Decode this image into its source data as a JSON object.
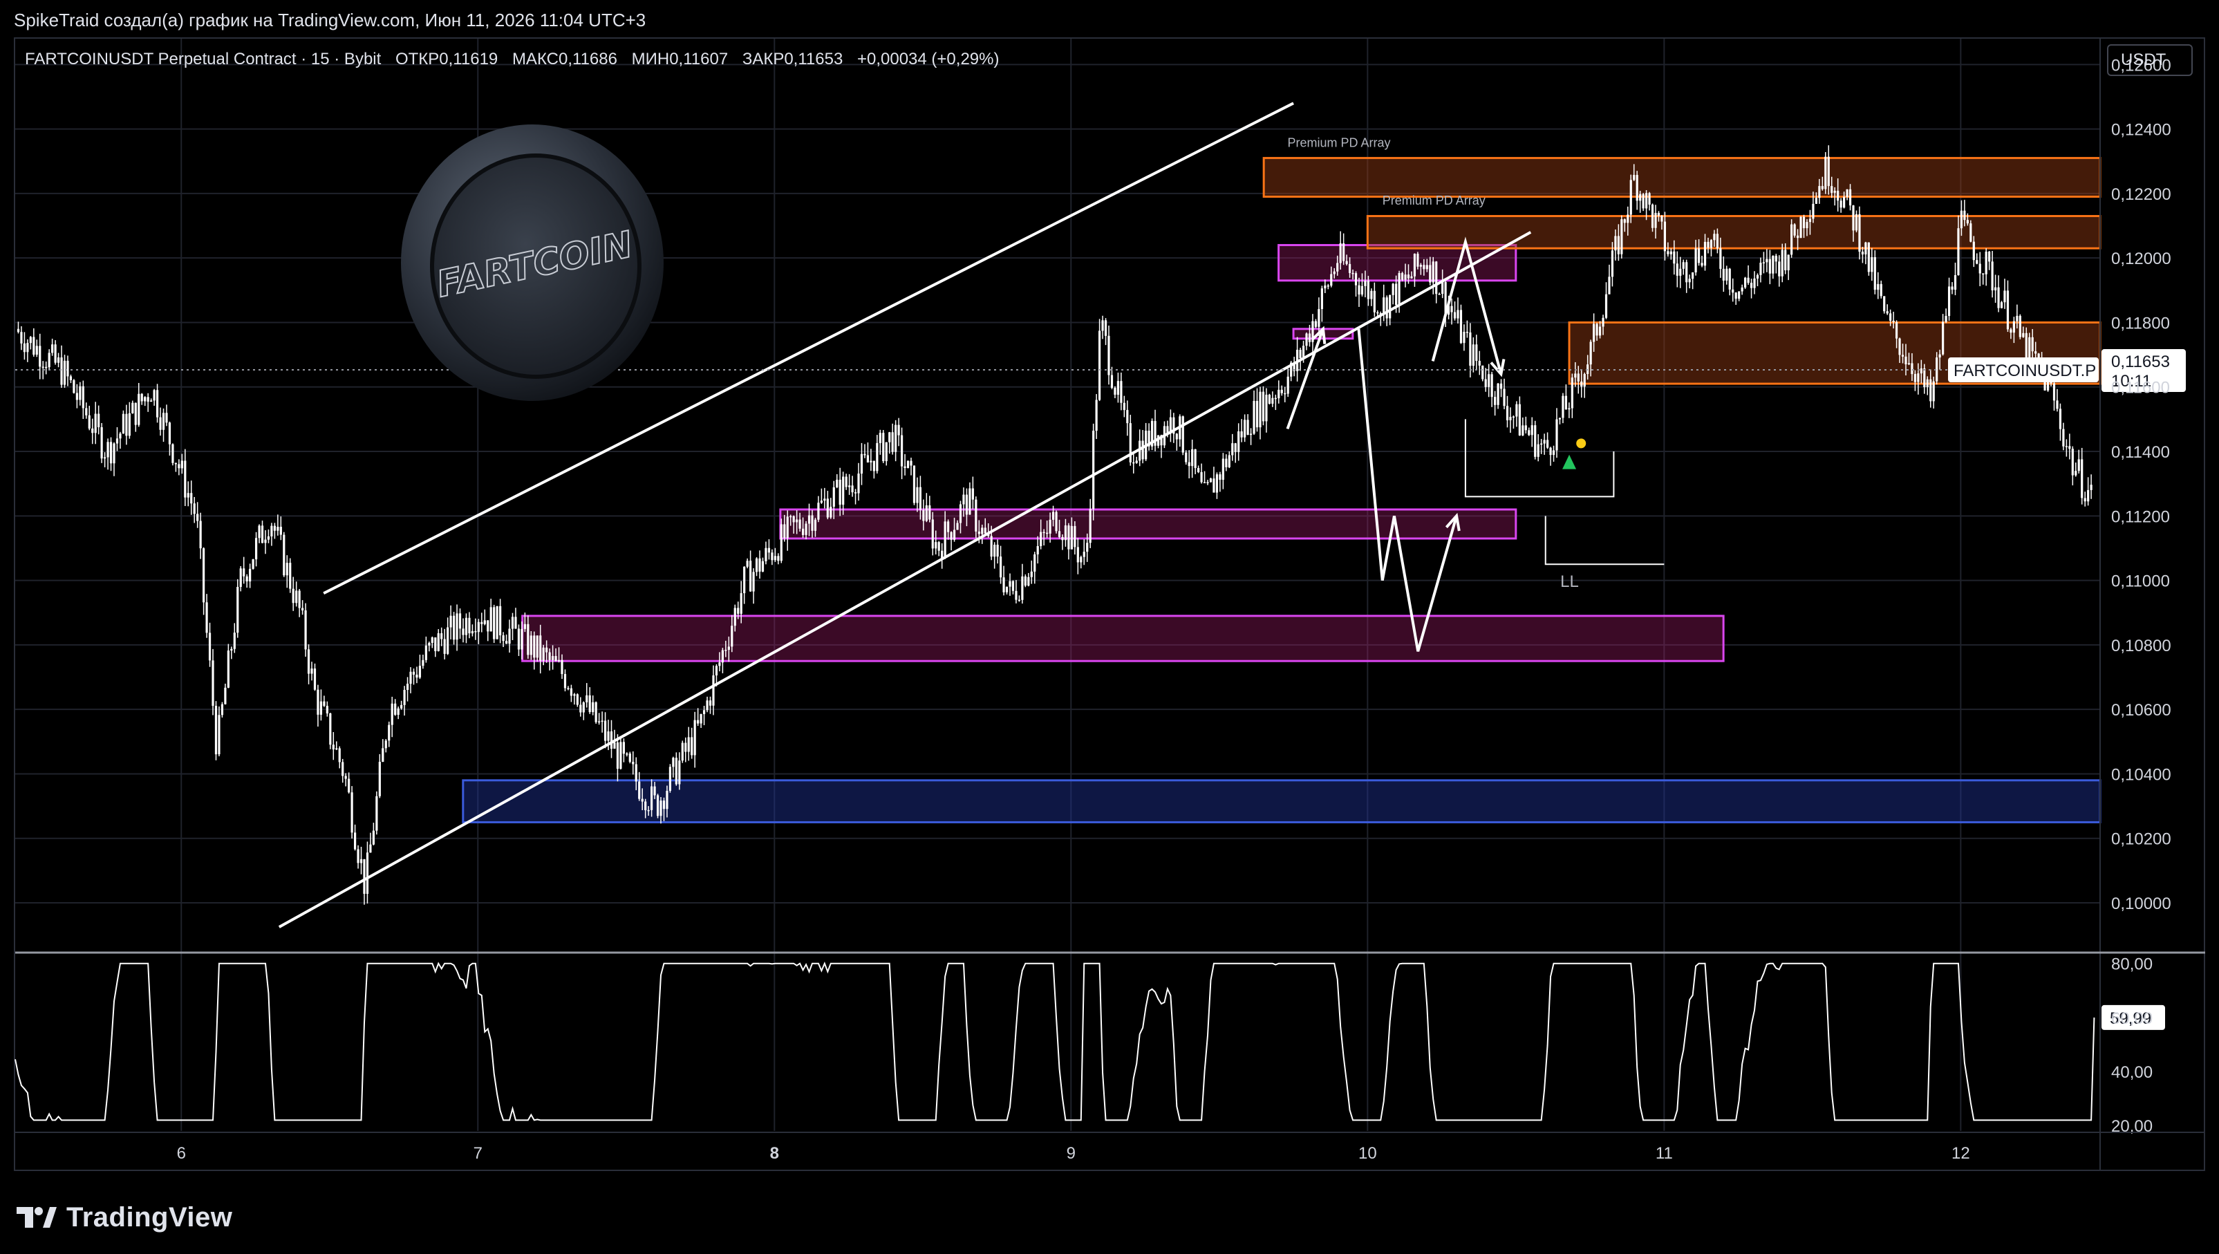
{
  "credit": "SpikeTraid создал(а) график на TradingView.com, Июн 11, 2026 11:04 UTC+3",
  "legend": {
    "symbol": "FARTCOINUSDT Perpetual Contract · 15 · Bybit",
    "open": "ОТКР0,11619",
    "high": "МАКС0,11686",
    "low": "МИН0,11607",
    "close": "ЗАКР0,11653",
    "change": "+0,00034 (+0,29%)"
  },
  "currency": "USDT",
  "price_label": {
    "ticker": "FARTCOINUSDT.P",
    "price": "0,11653",
    "countdown": "10:11"
  },
  "oscillator_label": "59,99",
  "annotations": {
    "pd_array_1": "Premium PD Array",
    "pd_array_2": "Premium PD Array",
    "ll": "LL"
  },
  "logo_text": "FARTCOIN",
  "footer": {
    "brand": "TradingView"
  },
  "colors": {
    "background": "#000000",
    "grid": "#1f222b",
    "candle": "#ffffff",
    "purple_zone": "#d946ef",
    "orange_zone": "#f97316",
    "blue_zone": "#3b5bdb",
    "oscillator": "#ffffff",
    "green": "#22c55e",
    "yellow": "#facc15"
  },
  "chart_data": {
    "type": "line",
    "subtype": "candlestick",
    "xlabel": "",
    "ylabel": "",
    "x_ticks": [
      "6",
      "7",
      "8",
      "9",
      "10",
      "11",
      "12"
    ],
    "x_range_days": [
      5.44,
      12.47
    ],
    "y_ticks": [
      "0,12600",
      "0,12400",
      "0,12200",
      "0,12000",
      "0,11800",
      "0,11600",
      "0,11400",
      "0,11200",
      "0,11000",
      "0,10800",
      "0,10600",
      "0,10400",
      "0,10200",
      "0,10000"
    ],
    "ylim": [
      0.0985,
      0.1268
    ],
    "price_series": [
      {
        "t": 5.44,
        "p": 0.1178
      },
      {
        "t": 5.6,
        "p": 0.1165
      },
      {
        "t": 5.75,
        "p": 0.114
      },
      {
        "t": 5.9,
        "p": 0.116
      },
      {
        "t": 6.05,
        "p": 0.112
      },
      {
        "t": 6.12,
        "p": 0.1048
      },
      {
        "t": 6.2,
        "p": 0.11
      },
      {
        "t": 6.3,
        "p": 0.112
      },
      {
        "t": 6.4,
        "p": 0.109
      },
      {
        "t": 6.45,
        "p": 0.1065
      },
      {
        "t": 6.55,
        "p": 0.104
      },
      {
        "t": 6.62,
        "p": 0.1005
      },
      {
        "t": 6.7,
        "p": 0.106
      },
      {
        "t": 6.85,
        "p": 0.108
      },
      {
        "t": 7.0,
        "p": 0.109
      },
      {
        "t": 7.15,
        "p": 0.1082
      },
      {
        "t": 7.3,
        "p": 0.107
      },
      {
        "t": 7.5,
        "p": 0.1042
      },
      {
        "t": 7.6,
        "p": 0.103
      },
      {
        "t": 7.75,
        "p": 0.1055
      },
      {
        "t": 7.9,
        "p": 0.11
      },
      {
        "t": 8.05,
        "p": 0.1115
      },
      {
        "t": 8.25,
        "p": 0.113
      },
      {
        "t": 8.4,
        "p": 0.1145
      },
      {
        "t": 8.55,
        "p": 0.111
      },
      {
        "t": 8.65,
        "p": 0.1125
      },
      {
        "t": 8.8,
        "p": 0.1095
      },
      {
        "t": 8.95,
        "p": 0.112
      },
      {
        "t": 9.05,
        "p": 0.1105
      },
      {
        "t": 9.1,
        "p": 0.118
      },
      {
        "t": 9.2,
        "p": 0.114
      },
      {
        "t": 9.35,
        "p": 0.115
      },
      {
        "t": 9.45,
        "p": 0.1125
      },
      {
        "t": 9.6,
        "p": 0.115
      },
      {
        "t": 9.75,
        "p": 0.1165
      },
      {
        "t": 9.9,
        "p": 0.12
      },
      {
        "t": 10.05,
        "p": 0.1185
      },
      {
        "t": 10.2,
        "p": 0.12
      },
      {
        "t": 10.35,
        "p": 0.117
      },
      {
        "t": 10.5,
        "p": 0.115
      },
      {
        "t": 10.6,
        "p": 0.114
      },
      {
        "t": 10.75,
        "p": 0.117
      },
      {
        "t": 10.9,
        "p": 0.1225
      },
      {
        "t": 11.05,
        "p": 0.1195
      },
      {
        "t": 11.15,
        "p": 0.1205
      },
      {
        "t": 11.25,
        "p": 0.119
      },
      {
        "t": 11.4,
        "p": 0.12
      },
      {
        "t": 11.55,
        "p": 0.1228
      },
      {
        "t": 11.65,
        "p": 0.121
      },
      {
        "t": 11.75,
        "p": 0.118
      },
      {
        "t": 11.85,
        "p": 0.1165
      },
      {
        "t": 11.9,
        "p": 0.1155
      },
      {
        "t": 12.0,
        "p": 0.121
      },
      {
        "t": 12.1,
        "p": 0.1195
      },
      {
        "t": 12.2,
        "p": 0.1175
      },
      {
        "t": 12.3,
        "p": 0.116
      },
      {
        "t": 12.38,
        "p": 0.1135
      },
      {
        "t": 12.45,
        "p": 0.1125
      }
    ],
    "zones": [
      {
        "kind": "purple",
        "t0": 7.15,
        "t1": 11.2,
        "y0": 0.1075,
        "y1": 0.1089
      },
      {
        "kind": "purple",
        "t0": 8.02,
        "t1": 10.5,
        "y0": 0.1113,
        "y1": 0.1122
      },
      {
        "kind": "purple",
        "t0": 9.7,
        "t1": 10.5,
        "y0": 0.1193,
        "y1": 0.1204
      },
      {
        "kind": "purple",
        "t0": 9.75,
        "t1": 9.95,
        "y0": 0.1175,
        "y1": 0.1178
      },
      {
        "kind": "orange",
        "t0": 9.65,
        "t1": 12.47,
        "y0": 0.1219,
        "y1": 0.1231
      },
      {
        "kind": "orange",
        "t0": 10.0,
        "t1": 12.47,
        "y0": 0.1203,
        "y1": 0.1213
      },
      {
        "kind": "orange",
        "t0": 10.68,
        "t1": 12.47,
        "y0": 0.1161,
        "y1": 0.118
      },
      {
        "kind": "blue",
        "t0": 6.95,
        "t1": 12.47,
        "y0": 0.1025,
        "y1": 0.1038
      }
    ],
    "channel": {
      "upper": [
        {
          "t": 6.48,
          "p": 0.1096
        },
        {
          "t": 9.75,
          "p": 0.1248
        }
      ],
      "lower": [
        {
          "t": 6.33,
          "p": 0.09925
        },
        {
          "t": 10.55,
          "p": 0.1208
        }
      ]
    },
    "path_arrows": [
      [
        {
          "t": 9.73,
          "p": 0.1147
        },
        {
          "t": 9.85,
          "p": 0.1178
        }
      ],
      [
        {
          "t": 10.22,
          "p": 0.1168
        },
        {
          "t": 10.33,
          "p": 0.1205
        },
        {
          "t": 10.45,
          "p": 0.1164
        }
      ],
      [
        {
          "t": 9.97,
          "p": 0.1178
        },
        {
          "t": 10.05,
          "p": 0.11
        },
        {
          "t": 10.09,
          "p": 0.112
        },
        {
          "t": 10.17,
          "p": 0.1078
        },
        {
          "t": 10.3,
          "p": 0.112
        }
      ]
    ],
    "oscillator": {
      "y_ticks": [
        "80,00",
        "60,00",
        "40,00",
        "20,00"
      ],
      "ylim": [
        18,
        83
      ],
      "last": 59.99
    }
  }
}
